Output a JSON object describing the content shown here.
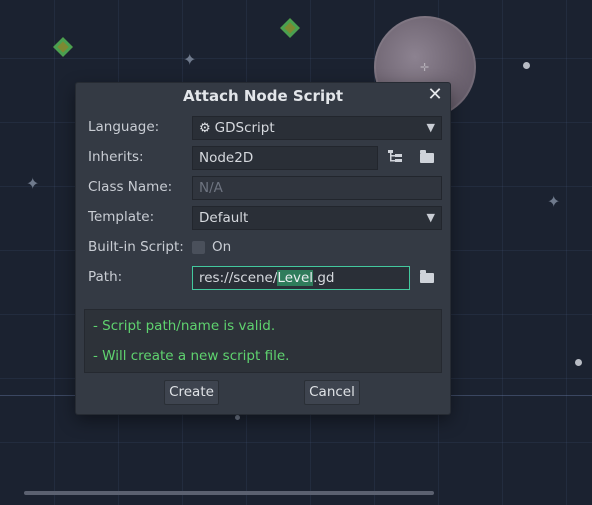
{
  "dialog": {
    "title": "Attach Node Script",
    "close_glyph": "✕",
    "fields": {
      "language": {
        "label": "Language:",
        "value": "GDScript",
        "icon": "gear-icon"
      },
      "inherits": {
        "label": "Inherits:",
        "value": "Node2D"
      },
      "class_name": {
        "label": "Class Name:",
        "placeholder": "N/A"
      },
      "template": {
        "label": "Template:",
        "value": "Default"
      },
      "builtin": {
        "label": "Built-in Script:",
        "option_label": "On",
        "checked": false
      },
      "path": {
        "label": "Path:",
        "prefix": "res://scene/",
        "selected": "Level",
        "suffix": ".gd"
      }
    },
    "status": {
      "line1": "- Script path/name is valid.",
      "line2": "- Will create a new script file."
    },
    "buttons": {
      "create": "Create",
      "cancel": "Cancel"
    }
  },
  "colors": {
    "status_valid": "#5fd36f",
    "path_focus_border": "#43c99e",
    "selection": "#2f7c5b"
  }
}
